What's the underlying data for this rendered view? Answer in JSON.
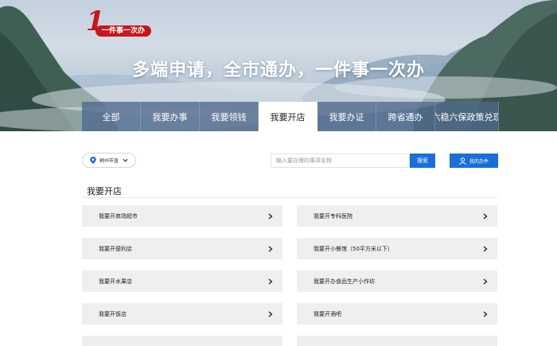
{
  "logo": {
    "mark": "1",
    "text": "一件事一次办"
  },
  "banner": {
    "slogan": "多端申请，全市通办，一件事一次办"
  },
  "tabs": [
    {
      "label": "全部",
      "active": false
    },
    {
      "label": "我要办事",
      "active": false
    },
    {
      "label": "我要领钱",
      "active": false
    },
    {
      "label": "我要开店",
      "active": true
    },
    {
      "label": "我要办证",
      "active": false
    },
    {
      "label": "跨省通办",
      "active": false
    },
    {
      "label": "六稳六保政策兑现",
      "active": false
    }
  ],
  "city_selector": {
    "value": "郴州市直"
  },
  "search": {
    "placeholder": "输入要办理的事项名称",
    "button_label": "搜索"
  },
  "my_items_button": {
    "label": "我的办件"
  },
  "section": {
    "title": "我要开店"
  },
  "items": [
    {
      "label": "我要开商场超市"
    },
    {
      "label": "我要开专科医院"
    },
    {
      "label": "我要开便利店"
    },
    {
      "label": "我要开小餐馆（50平方米以下）"
    },
    {
      "label": "我要开水果店"
    },
    {
      "label": "我要开办食品生产小作坊"
    },
    {
      "label": "我要开饭店"
    },
    {
      "label": "我要开酒吧"
    },
    {
      "label": ""
    },
    {
      "label": ""
    }
  ],
  "colors": {
    "primary": "#1a6ed8",
    "tab_bg": "#4e688c",
    "item_bg": "#efeff1",
    "logo_red": "#c8161d"
  }
}
